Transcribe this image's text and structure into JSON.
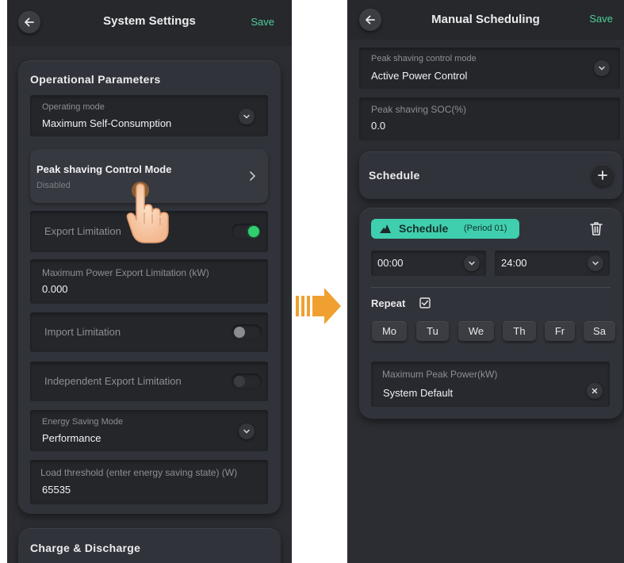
{
  "left_screen": {
    "header": {
      "title": "System Settings",
      "save_label": "Save",
      "back_icon": "arrow-left-icon"
    },
    "operational": {
      "title": "Operational Parameters",
      "operating_mode": {
        "label": "Operating mode",
        "value": "Maximum Self-Consumption"
      },
      "peak_shaving": {
        "title": "Peak shaving Control Mode",
        "status": "Disabled"
      },
      "export_limitation": {
        "label": "Export Limitation",
        "enabled": true
      },
      "max_power_export": {
        "label": "Maximum Power Export Limitation (kW)",
        "value": "0.000"
      },
      "import_limitation": {
        "label": "Import Limitation",
        "enabled": false
      },
      "independent_export": {
        "label": "Independent Export Limitation",
        "enabled": false
      },
      "energy_saving": {
        "label": "Energy Saving Mode",
        "value": "Performance"
      },
      "load_threshold": {
        "label": "Load threshold (enter energy saving state) (W)",
        "value": "65535"
      }
    },
    "charge_discharge": {
      "title": "Charge & Discharge"
    }
  },
  "right_screen": {
    "header": {
      "title": "Manual Scheduling",
      "save_label": "Save",
      "back_icon": "arrow-left-icon"
    },
    "peak_mode": {
      "label": "Peak shaving control mode",
      "value": "Active Power Control"
    },
    "peak_soc": {
      "label": "Peak shaving SOC(%)",
      "value": "0.0"
    },
    "schedule": {
      "title": "Schedule"
    },
    "period": {
      "badge_label": "Schedule",
      "period_label": "(Period 01)",
      "start_time": "00:00",
      "end_time": "24:00",
      "repeat_label": "Repeat",
      "repeat_checked": true,
      "days": [
        "Mo",
        "Tu",
        "We",
        "Th",
        "Fr",
        "Sa"
      ],
      "max_peak_power": {
        "label": "Maximum Peak Power(kW)",
        "value": "System Default"
      }
    }
  },
  "colors": {
    "accent_green": "#4ecf9a",
    "teal_badge": "#3fcfae",
    "arrow_orange": "#f0a030",
    "toggle_on": "#2fcf6e"
  }
}
